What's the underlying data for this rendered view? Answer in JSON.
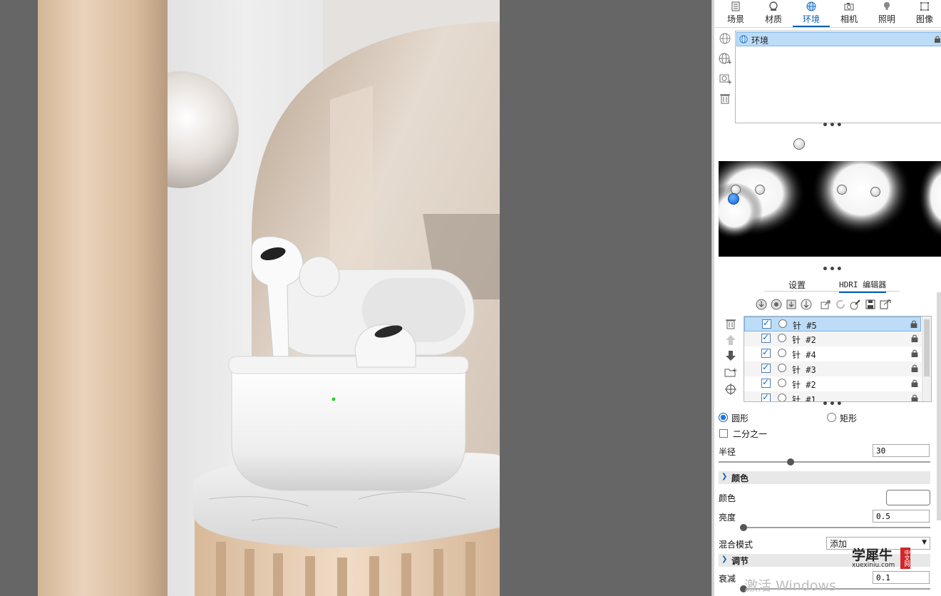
{
  "panel": {
    "tabs": [
      {
        "label": "场景",
        "icon": "scene-icon"
      },
      {
        "label": "材质",
        "icon": "material-icon"
      },
      {
        "label": "环境",
        "icon": "environment-globe-icon",
        "active": true
      },
      {
        "label": "相机",
        "icon": "camera-icon"
      },
      {
        "label": "照明",
        "icon": "light-bulb-icon"
      },
      {
        "label": "图像",
        "icon": "image-icon"
      }
    ],
    "environments": [
      {
        "label": "环境",
        "selected": true
      }
    ],
    "subtabs": [
      {
        "label": "设置"
      },
      {
        "label": "HDRI 编辑器",
        "active": true
      }
    ],
    "pins": [
      {
        "label": "针 #5",
        "checked": true,
        "selected": true
      },
      {
        "label": "针 #2",
        "checked": true
      },
      {
        "label": "针 #4",
        "checked": true
      },
      {
        "label": "针 #3",
        "checked": true
      },
      {
        "label": "针 #2",
        "checked": true
      },
      {
        "label": "针 #1",
        "checked": true
      }
    ],
    "shape": {
      "circle_label": "圆形",
      "rect_label": "矩形",
      "selected": "圆形",
      "half_label": "二分之一",
      "half_checked": false
    },
    "radius": {
      "label": "半径",
      "value": "30",
      "slider": 0.3
    },
    "color_section": {
      "title": "颜色",
      "color_label": "颜色",
      "color_value": "#ffffff",
      "brightness_label": "亮度",
      "brightness_value": "0.5",
      "brightness_slider": 0.0,
      "blend_label": "混合模式",
      "blend_value": "添加"
    },
    "adjust_section": {
      "title": "调节",
      "falloff_label": "衰减",
      "falloff_value": "0.1",
      "falloff_slider": 0.0
    }
  },
  "overlays": {
    "watermark_main": "学犀牛",
    "watermark_site": "xuexiniu.com",
    "watermark_side": "中文网",
    "activate_text": "激活 Windows"
  },
  "colors": {
    "accent": "#0a5fb4",
    "selection": "#bcdcf7",
    "viewport_bg": "#666666"
  }
}
